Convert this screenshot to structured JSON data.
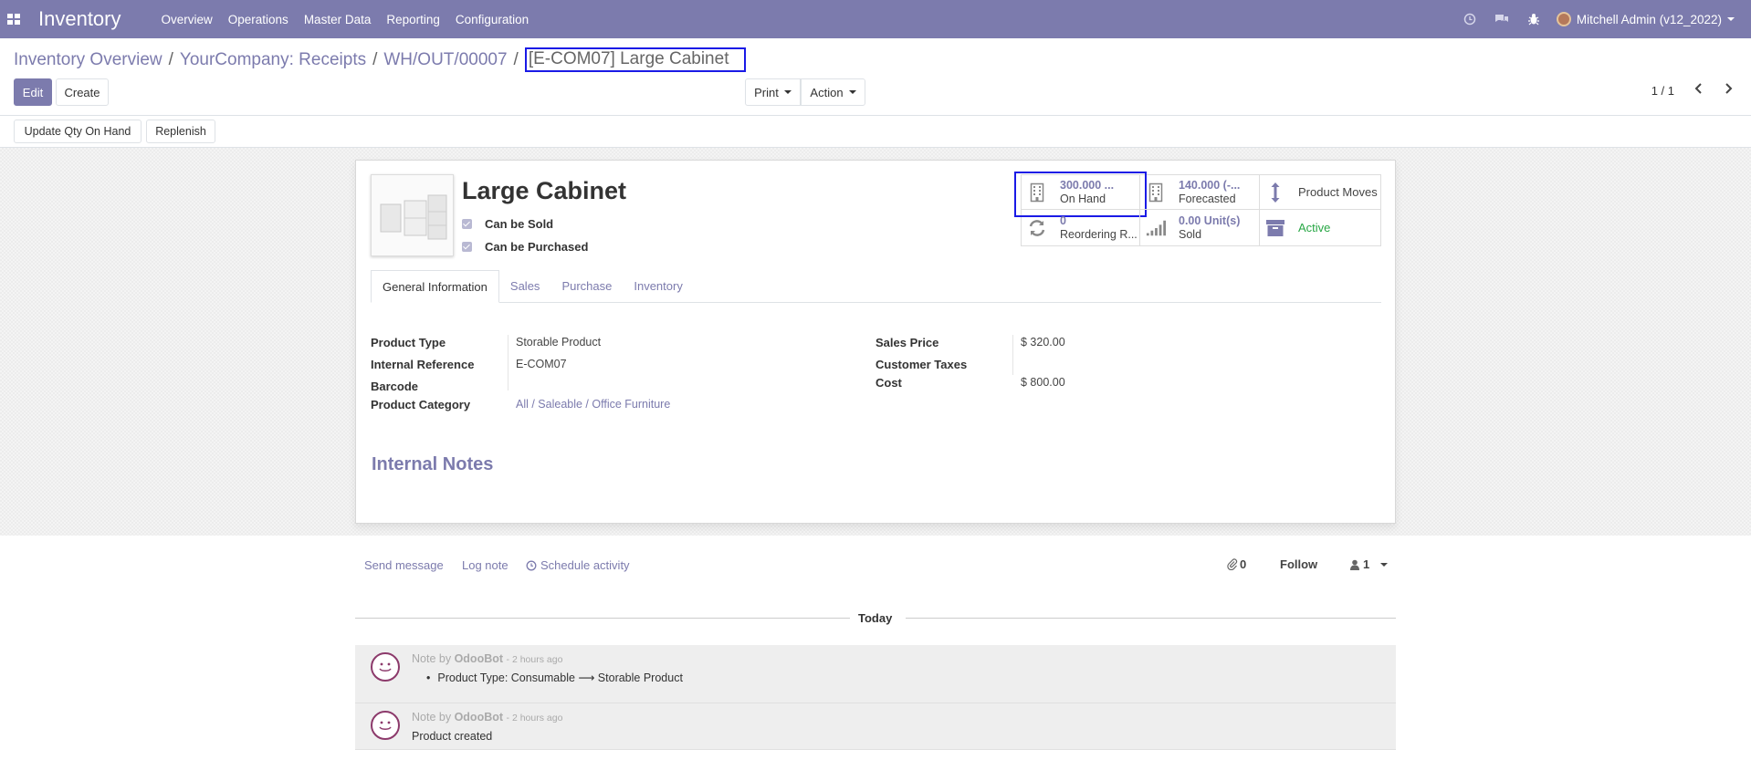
{
  "navbar": {
    "app_name": "Inventory",
    "menu": [
      "Overview",
      "Operations",
      "Master Data",
      "Reporting",
      "Configuration"
    ],
    "user": "Mitchell Admin (v12_2022)",
    "bg_color": "#7c7bad"
  },
  "breadcrumb": {
    "items": [
      "Inventory Overview",
      "YourCompany: Receipts",
      "WH/OUT/00007"
    ],
    "current": "[E-COM07] Large Cabinet",
    "sep": "/"
  },
  "buttons": {
    "edit": "Edit",
    "create": "Create",
    "print": "Print",
    "action": "Action",
    "update_qty": "Update Qty On Hand",
    "replenish": "Replenish"
  },
  "pager": {
    "value": "1 / 1"
  },
  "product": {
    "name": "Large Cabinet",
    "can_be_sold": "Can be Sold",
    "can_be_purchased": "Can be Purchased"
  },
  "stats": {
    "on_hand_value": "300.000 ...",
    "on_hand_label": "On Hand",
    "forecast_value": "140.000 (-...",
    "forecast_label": "Forecasted",
    "moves_label": "Product Moves",
    "reorder_value": "0",
    "reorder_label": "Reordering R...",
    "sold_value": "0.00 Unit(s)",
    "sold_label": "Sold",
    "active_label": "Active"
  },
  "tabs": [
    "General Information",
    "Sales",
    "Purchase",
    "Inventory"
  ],
  "fields": {
    "product_type_label": "Product Type",
    "product_type_value": "Storable Product",
    "internal_ref_label": "Internal Reference",
    "internal_ref_value": "E-COM07",
    "barcode_label": "Barcode",
    "category_label": "Product Category",
    "category_value": "All / Saleable / Office Furniture",
    "sales_price_label": "Sales Price",
    "sales_price_value": "$ 320.00",
    "customer_taxes_label": "Customer Taxes",
    "cost_label": "Cost",
    "cost_value": "$ 800.00"
  },
  "notes_title": "Internal Notes",
  "chatter": {
    "send_message": "Send message",
    "log_note": "Log note",
    "schedule_activity": "Schedule activity",
    "attachments": "0",
    "follow": "Follow",
    "followers": "1",
    "today": "Today",
    "messages": [
      {
        "prefix": "Note by",
        "author": "OdooBot",
        "time": "- 2 hours ago",
        "body": "Product Type: Consumable ⟶ Storable Product"
      },
      {
        "prefix": "Note by",
        "author": "OdooBot",
        "time": "- 2 hours ago",
        "body": "Product created"
      }
    ]
  }
}
